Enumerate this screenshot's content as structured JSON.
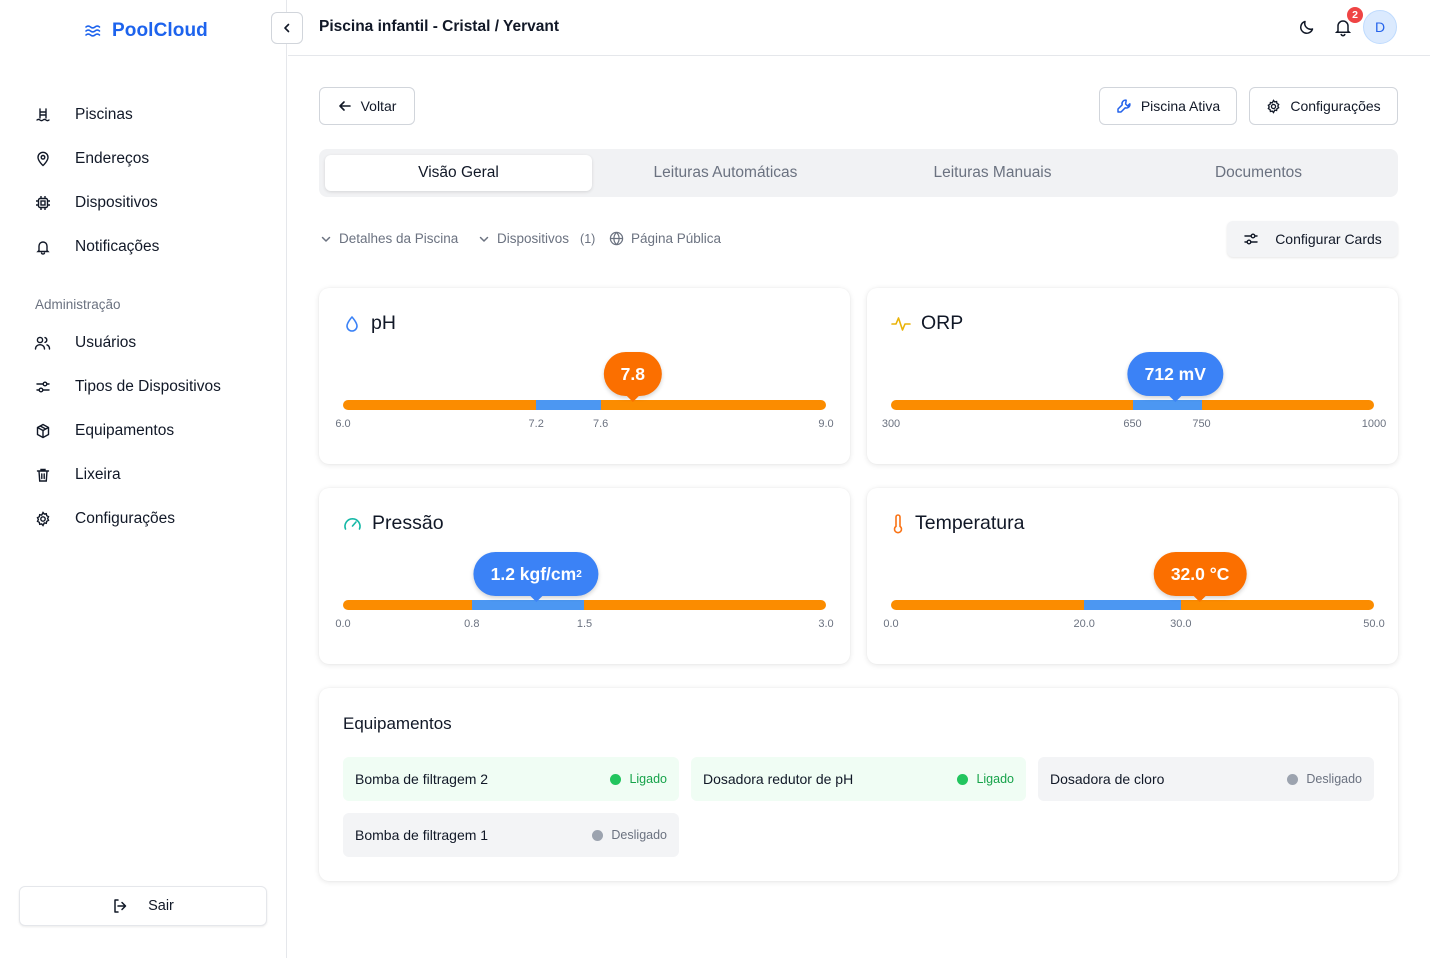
{
  "brand": {
    "name": "PoolCloud"
  },
  "sidebar": {
    "items": [
      {
        "label": "Piscinas",
        "icon": "pool-ladder-icon"
      },
      {
        "label": "Endereços",
        "icon": "map-pin-icon"
      },
      {
        "label": "Dispositivos",
        "icon": "chip-icon"
      },
      {
        "label": "Notificações",
        "icon": "bell-icon"
      }
    ],
    "admin_label": "Administração",
    "admin_items": [
      {
        "label": "Usuários",
        "icon": "users-icon"
      },
      {
        "label": "Tipos de Dispositivos",
        "icon": "sliders-icon"
      },
      {
        "label": "Equipamentos",
        "icon": "box-icon"
      },
      {
        "label": "Lixeira",
        "icon": "trash-icon"
      },
      {
        "label": "Configurações",
        "icon": "gear-icon"
      }
    ],
    "logout_label": "Sair"
  },
  "header": {
    "title": "Piscina infantil - Cristal / Yervant",
    "notification_count": "2",
    "avatar_initial": "D"
  },
  "actions": {
    "back_label": "Voltar",
    "active_label": "Piscina Ativa",
    "config_label": "Configurações"
  },
  "tabs": [
    {
      "label": "Visão Geral",
      "active": true
    },
    {
      "label": "Leituras Automáticas",
      "active": false
    },
    {
      "label": "Leituras Manuais",
      "active": false
    },
    {
      "label": "Documentos",
      "active": false
    }
  ],
  "sections": {
    "details_label": "Detalhes da Piscina",
    "devices_label": "Dispositivos",
    "devices_count": "(1)",
    "public_label": "Página Pública",
    "config_cards_label": "Configurar Cards"
  },
  "gauges": {
    "ph": {
      "title": "pH",
      "value": 7.8,
      "display": "7.8",
      "min": 6.0,
      "max": 9.0,
      "ok_low": 7.2,
      "ok_high": 7.6,
      "ticks": [
        "6.0",
        "7.2",
        "7.6",
        "9.0"
      ],
      "state": "out-of-range",
      "color": "#fb6f00"
    },
    "orp": {
      "title": "ORP",
      "value": 712,
      "display": "712 mV",
      "min": 300,
      "max": 1000,
      "ok_low": 650,
      "ok_high": 750,
      "ticks": [
        "300",
        "650",
        "750",
        "1000"
      ],
      "state": "in-range",
      "color": "#3b82f6"
    },
    "pressure": {
      "title": "Pressão",
      "value": 1.2,
      "display": "1.2 kgf/cm",
      "unit_sup": "2",
      "min": 0.0,
      "max": 3.0,
      "ok_low": 0.8,
      "ok_high": 1.5,
      "ticks": [
        "0.0",
        "0.8",
        "1.5",
        "3.0"
      ],
      "state": "in-range",
      "color": "#3b82f6"
    },
    "temperature": {
      "title": "Temperatura",
      "value": 32.0,
      "display": "32.0 °C",
      "min": 0.0,
      "max": 50.0,
      "ok_low": 20.0,
      "ok_high": 30.0,
      "ticks": [
        "0.0",
        "20.0",
        "30.0",
        "50.0"
      ],
      "state": "out-of-range",
      "color": "#fb6f00"
    }
  },
  "equipment": {
    "title": "Equipamentos",
    "items": [
      {
        "name": "Bomba de filtragem 2",
        "status": "Ligado",
        "on": true
      },
      {
        "name": "Dosadora redutor de pH",
        "status": "Ligado",
        "on": true
      },
      {
        "name": "Dosadora de cloro",
        "status": "Desligado",
        "on": false
      },
      {
        "name": "Bomba de filtragem 1",
        "status": "Desligado",
        "on": false
      }
    ]
  },
  "colors": {
    "brand": "#1d63ed",
    "gauge_out": "#fb8c00",
    "gauge_ok": "#4c97f2",
    "status_on": "#22c55e",
    "status_off": "#9ca3af"
  }
}
